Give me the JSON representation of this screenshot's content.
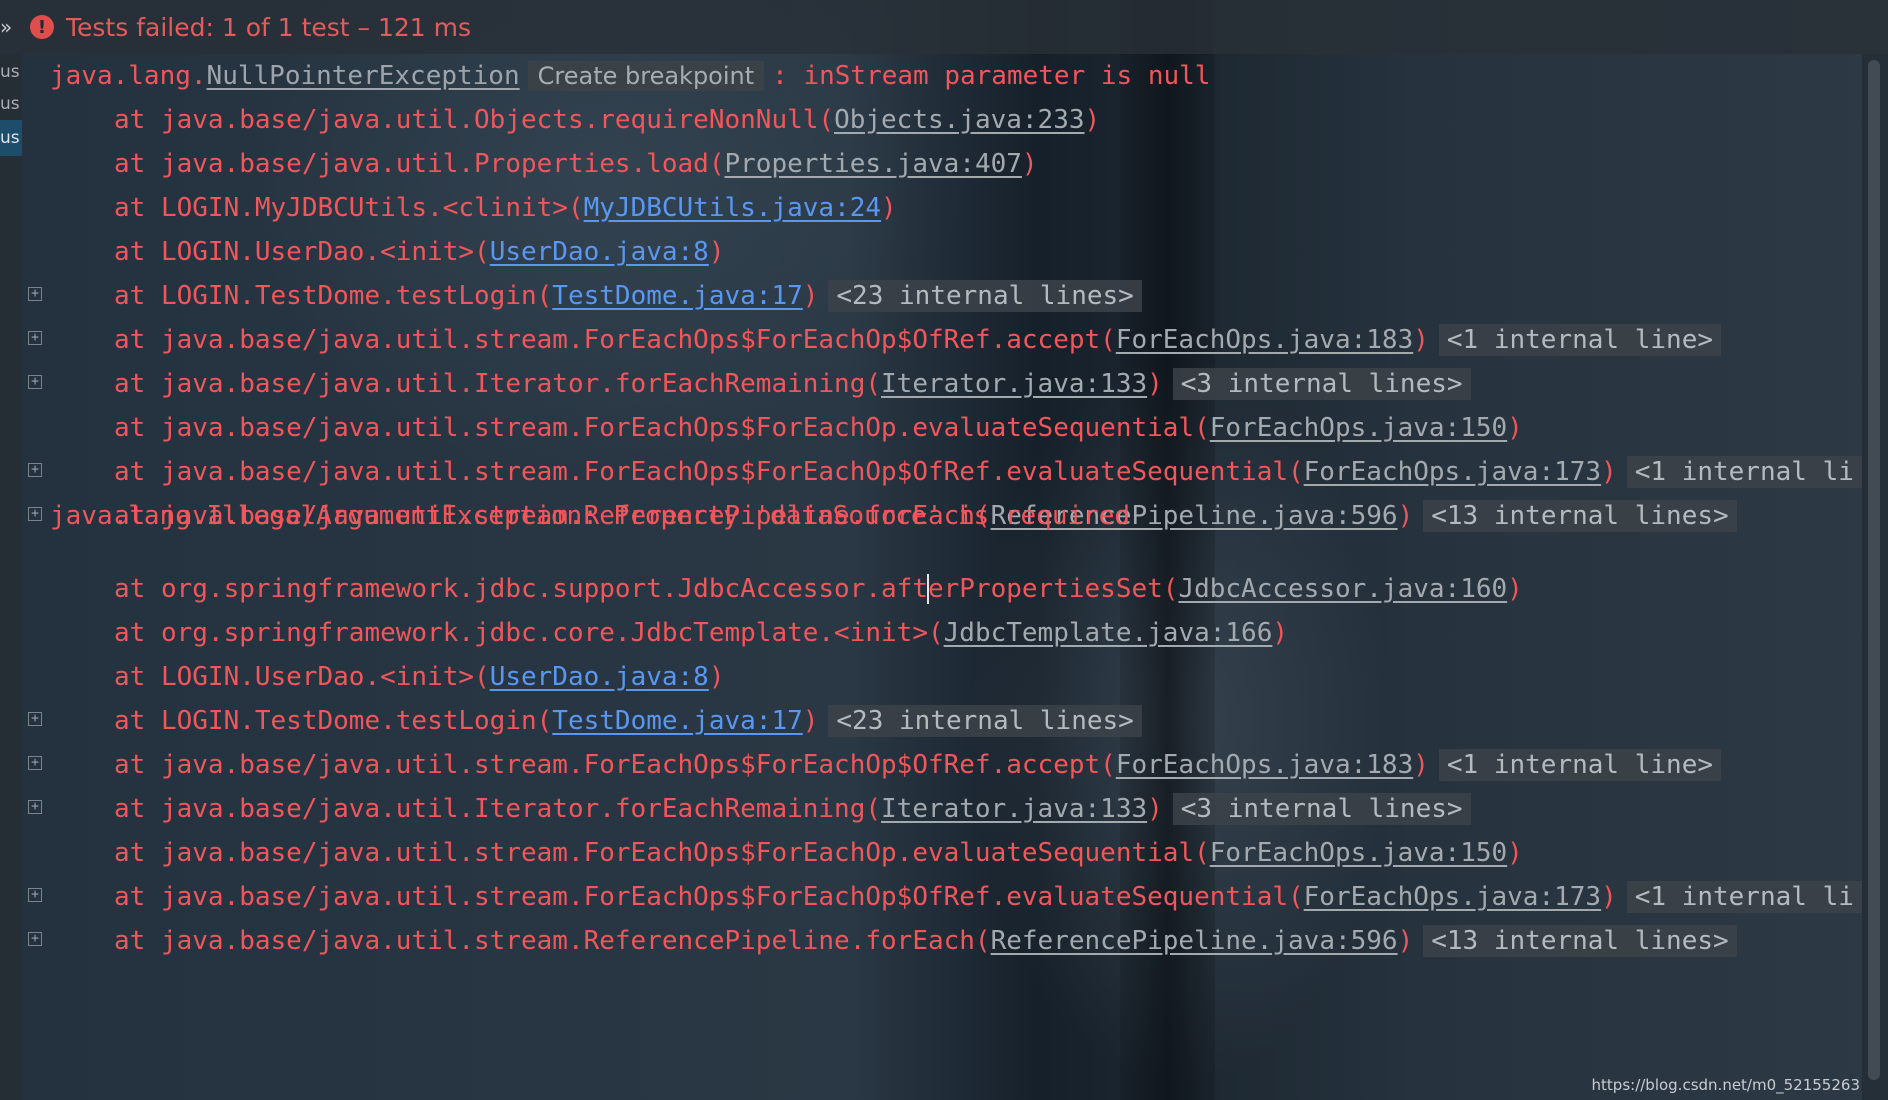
{
  "header": {
    "chevron": "»",
    "status_icon": "error-icon",
    "status_text": "Tests failed: 1 of 1 test – 121 ms"
  },
  "sidebar": {
    "tags": [
      "us",
      "us",
      "us"
    ]
  },
  "console": {
    "exception1": {
      "prefix": "java.lang.",
      "cls": "NullPointerException",
      "breakpoint_label": "Create breakpoint",
      "message": ": inStream parameter is null"
    },
    "block1": [
      {
        "at": "at java.base/java.util.Objects.requireNonNull(",
        "link": "Objects.java:233",
        "end": ")",
        "chip": "",
        "fold": false,
        "blue": false
      },
      {
        "at": "at java.base/java.util.Properties.load(",
        "link": "Properties.java:407",
        "end": ")",
        "chip": "",
        "fold": false,
        "blue": false
      },
      {
        "at": "at LOGIN.MyJDBCUtils.<clinit>(",
        "link": "MyJDBCUtils.java:24",
        "end": ")",
        "chip": "",
        "fold": false,
        "blue": true
      },
      {
        "at": "at LOGIN.UserDao.<init>(",
        "link": "UserDao.java:8",
        "end": ")",
        "chip": "",
        "fold": false,
        "blue": true
      },
      {
        "at": "at LOGIN.TestDome.testLogin(",
        "link": "TestDome.java:17",
        "end": ")",
        "chip": "<23 internal lines>",
        "fold": true,
        "blue": true
      },
      {
        "at": "at java.base/java.util.stream.ForEachOps$ForEachOp$OfRef.accept(",
        "link": "ForEachOps.java:183",
        "end": ")",
        "chip": "<1 internal line>",
        "fold": true,
        "blue": false
      },
      {
        "at": "at java.base/java.util.Iterator.forEachRemaining(",
        "link": "Iterator.java:133",
        "end": ")",
        "chip": "<3 internal lines>",
        "fold": true,
        "blue": false
      },
      {
        "at": "at java.base/java.util.stream.ForEachOps$ForEachOp.evaluateSequential(",
        "link": "ForEachOps.java:150",
        "end": ")",
        "chip": "",
        "fold": false,
        "blue": false
      },
      {
        "at": "at java.base/java.util.stream.ForEachOps$ForEachOp$OfRef.evaluateSequential(",
        "link": "ForEachOps.java:173",
        "end": ")",
        "chip": "<1 internal li",
        "fold": true,
        "blue": false
      },
      {
        "at": "at java.base/java.util.stream.ReferencePipeline.forEach(",
        "link": "ReferencePipeline.java:596",
        "end": ")",
        "chip": "<13 internal lines>",
        "fold": true,
        "blue": false
      }
    ],
    "exception2": "java.lang.IllegalArgumentException: Property 'dataSource' is required",
    "block2_first": {
      "at_before_caret": "at org.springframework.jdbc.support.JdbcAccessor.aft",
      "at_after_caret": "erPropertiesSet(",
      "link": "JdbcAccessor.java:160",
      "end": ")"
    },
    "block2": [
      {
        "at": "at org.springframework.jdbc.core.JdbcTemplate.<init>(",
        "link": "JdbcTemplate.java:166",
        "end": ")",
        "chip": "",
        "fold": false,
        "blue": false
      },
      {
        "at": "at LOGIN.UserDao.<init>(",
        "link": "UserDao.java:8",
        "end": ")",
        "chip": "",
        "fold": false,
        "blue": true
      },
      {
        "at": "at LOGIN.TestDome.testLogin(",
        "link": "TestDome.java:17",
        "end": ")",
        "chip": "<23 internal lines>",
        "fold": true,
        "blue": true
      },
      {
        "at": "at java.base/java.util.stream.ForEachOps$ForEachOp$OfRef.accept(",
        "link": "ForEachOps.java:183",
        "end": ")",
        "chip": "<1 internal line>",
        "fold": true,
        "blue": false
      },
      {
        "at": "at java.base/java.util.Iterator.forEachRemaining(",
        "link": "Iterator.java:133",
        "end": ")",
        "chip": "<3 internal lines>",
        "fold": true,
        "blue": false
      },
      {
        "at": "at java.base/java.util.stream.ForEachOps$ForEachOp.evaluateSequential(",
        "link": "ForEachOps.java:150",
        "end": ")",
        "chip": "",
        "fold": false,
        "blue": false
      },
      {
        "at": "at java.base/java.util.stream.ForEachOps$ForEachOp$OfRef.evaluateSequential(",
        "link": "ForEachOps.java:173",
        "end": ")",
        "chip": "<1 internal li",
        "fold": true,
        "blue": false
      },
      {
        "at": "at java.base/java.util.stream.ReferencePipeline.forEach(",
        "link": "ReferencePipeline.java:596",
        "end": ")",
        "chip": "<13 internal lines>",
        "fold": true,
        "blue": false
      }
    ],
    "fold_glyph": "+"
  },
  "watermark": "https://blog.csdn.net/m0_52155263",
  "colors": {
    "error_text": "#f0565a",
    "link_gray": "#a4a9ae",
    "link_blue": "#5a97f0",
    "selected_tab": "#1d4d6a"
  }
}
